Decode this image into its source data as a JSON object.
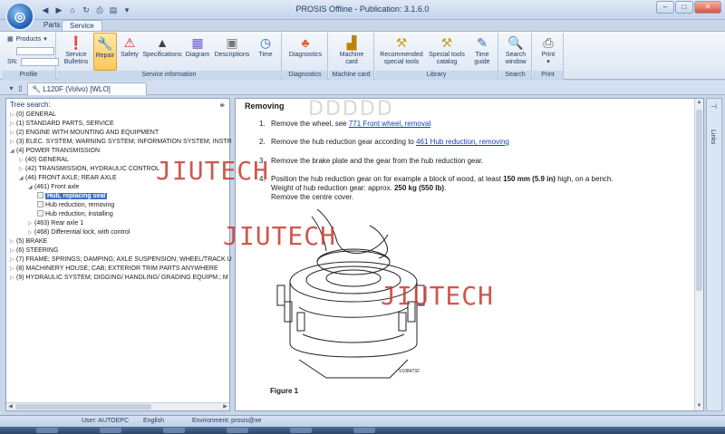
{
  "app": {
    "title": "PROSIS Offline - Publication: 3.1.6.0",
    "window_buttons": [
      "–",
      "□",
      "✕"
    ]
  },
  "ribbon": {
    "tabs": [
      {
        "label": "Parts",
        "active": false
      },
      {
        "label": "Service",
        "active": true
      }
    ],
    "profile": {
      "products_label": "Products",
      "sn_label": "SN:",
      "group_label": "Profile"
    },
    "groups": [
      {
        "label": "Service information",
        "buttons": [
          {
            "label_1": "Service",
            "label_2": "Bulletins",
            "icon": "bulletin-icon"
          },
          {
            "label_1": "Repair",
            "label_2": "",
            "icon": "wrench-icon",
            "active": true
          },
          {
            "label_1": "Safety",
            "label_2": "",
            "icon": "warning-icon"
          },
          {
            "label_1": "Specifications",
            "label_2": "",
            "icon": "spec-icon"
          },
          {
            "label_1": "Diagram",
            "label_2": "",
            "icon": "diagram-icon"
          },
          {
            "label_1": "Descriptions",
            "label_2": "",
            "icon": "description-icon"
          },
          {
            "label_1": "Time",
            "label_2": "",
            "icon": "clock-icon"
          }
        ]
      },
      {
        "label": "Diagnostics",
        "buttons": [
          {
            "label_1": "Diagnostics",
            "label_2": "",
            "icon": "diagnostics-icon"
          }
        ]
      },
      {
        "label": "Machine card",
        "buttons": [
          {
            "label_1": "Machine",
            "label_2": "card",
            "icon": "machine-icon"
          }
        ]
      },
      {
        "label": "Library",
        "buttons": [
          {
            "label_1": "Recommended",
            "label_2": "special tools",
            "icon": "tools-icon"
          },
          {
            "label_1": "Special tools",
            "label_2": "catalog",
            "icon": "tools-catalog-icon"
          },
          {
            "label_1": "Time",
            "label_2": "guide",
            "icon": "time-guide-icon"
          }
        ]
      },
      {
        "label": "Search",
        "buttons": [
          {
            "label_1": "Search",
            "label_2": "window",
            "icon": "search-icon"
          }
        ]
      },
      {
        "label": "Print",
        "buttons": [
          {
            "label_1": "Print",
            "label_2": "",
            "icon": "printer-icon"
          }
        ]
      }
    ]
  },
  "document_tab": {
    "label": "L120F (Volvo) [WLO]"
  },
  "tree": {
    "header": "Tree search:",
    "items": [
      {
        "text": "(0) GENERAL",
        "level": 0,
        "type": "collapsed"
      },
      {
        "text": "(1) STANDARD PARTS, SERVICE",
        "level": 0,
        "type": "collapsed"
      },
      {
        "text": "(2) ENGINE WITH MOUNTING AND EQUIPMENT",
        "level": 0,
        "type": "collapsed"
      },
      {
        "text": "(3) ELEC. SYSTEM; WARNING SYSTEM; INFORMATION  SYSTEM; INSTR",
        "level": 0,
        "type": "collapsed"
      },
      {
        "text": "(4) POWER TRANSMISSION",
        "level": 0,
        "type": "expanded"
      },
      {
        "text": "(40) GENERAL",
        "level": 1,
        "type": "collapsed"
      },
      {
        "text": "(42) TRANSMISSION, HYDRAULIC CONTROL",
        "level": 1,
        "type": "collapsed"
      },
      {
        "text": "(46) FRONT AXLE; REAR AXLE",
        "level": 1,
        "type": "expanded"
      },
      {
        "text": "(461) Front axle",
        "level": 2,
        "type": "expanded"
      },
      {
        "text": "Hub, replacing seal",
        "level": 3,
        "type": "leaf",
        "selected": true
      },
      {
        "text": "Hub reduction, removing",
        "level": 3,
        "type": "leaf"
      },
      {
        "text": "Hub reduction, installing",
        "level": 3,
        "type": "leaf"
      },
      {
        "text": "(463) Rear axle 1",
        "level": 2,
        "type": "collapsed"
      },
      {
        "text": "(468) Differential lock, with control",
        "level": 2,
        "type": "collapsed"
      },
      {
        "text": "(5) BRAKE",
        "level": 0,
        "type": "collapsed"
      },
      {
        "text": "(6) STEERING",
        "level": 0,
        "type": "collapsed"
      },
      {
        "text": "(7) FRAME; SPRINGS; DAMPING; AXLE SUSPENSION;  WHEEL/TRACK U",
        "level": 0,
        "type": "collapsed"
      },
      {
        "text": "(8) MACHINERY HOUSE; CAB; EXTERIOR TRIM PARTS  ANYWHERE",
        "level": 0,
        "type": "collapsed"
      },
      {
        "text": "(9) HYDRAULIC SYSTEM; DIGGING/ HANDLING/  GRADING EQUIPM.; M",
        "level": 0,
        "type": "collapsed"
      }
    ]
  },
  "document": {
    "heading": "Removing",
    "steps": [
      {
        "num": "1.",
        "pre": "Remove the wheel, see ",
        "link": "771 Front wheel, removal",
        "post": ""
      },
      {
        "num": "2.",
        "pre": "Remove the hub reduction gear according to ",
        "link": "461 Hub reduction, removing",
        "post": ""
      },
      {
        "num": "3.",
        "pre": "Remove the brake plate and the gear from the hub reduction gear.",
        "link": "",
        "post": ""
      },
      {
        "num": "4.",
        "pre": "Position the hub reduction gear on for example a block of wood, at least ",
        "bold1": "150 mm (5.9 in)",
        "mid": " high, on a bench.",
        "line2_pre": "Weight of hub reduction gear: approx. ",
        "bold2": "250 kg (550 lb)",
        "line2_post": ".",
        "line3": "Remove the centre cover."
      }
    ],
    "figure_code": "V1084732",
    "figure_caption": "Figure 1"
  },
  "links_pane": {
    "label": "Links"
  },
  "watermarks": {
    "text": "JIUTECH",
    "faint": "DDDDD"
  },
  "status": {
    "user": "User: AUTOEPC",
    "language": "English",
    "environment": "Environment: prosis@xe"
  },
  "colors": {
    "accent": "#3d6fc2",
    "link": "#1a3db8",
    "watermark": "#c93a2e",
    "active_button": "#ffc75a"
  }
}
